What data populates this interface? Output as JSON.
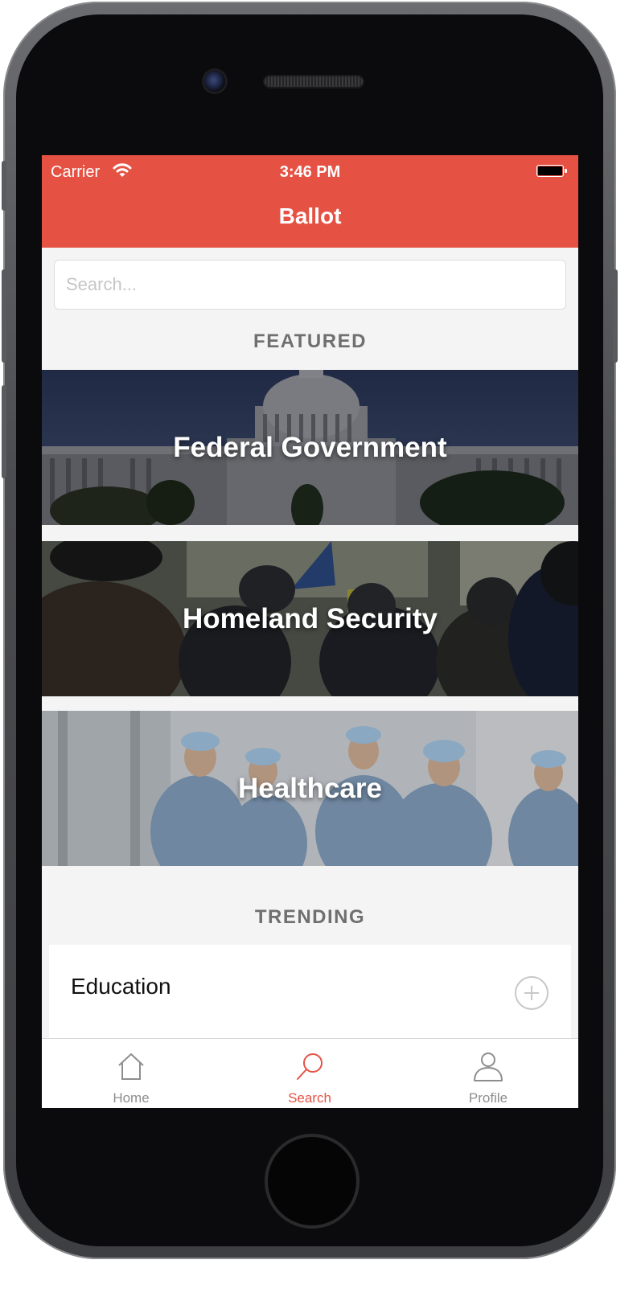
{
  "status_bar": {
    "carrier": "Carrier",
    "time": "3:46 PM"
  },
  "nav": {
    "title": "Ballot"
  },
  "search": {
    "placeholder": "Search..."
  },
  "featured": {
    "title": "FEATURED",
    "cards": [
      {
        "label": "Federal Government"
      },
      {
        "label": "Homeland Security"
      },
      {
        "label": "Healthcare"
      }
    ]
  },
  "trending": {
    "title": "TRENDING",
    "items": [
      {
        "label": "Education"
      }
    ]
  },
  "tabbar": {
    "tabs": [
      {
        "label": "Home",
        "icon": "home-icon",
        "active": false
      },
      {
        "label": "Search",
        "icon": "search-icon",
        "active": true
      },
      {
        "label": "Profile",
        "icon": "profile-icon",
        "active": false
      }
    ]
  },
  "colors": {
    "accent": "#e55244",
    "background": "#f4f4f4",
    "inactive": "#8e8e8e"
  }
}
